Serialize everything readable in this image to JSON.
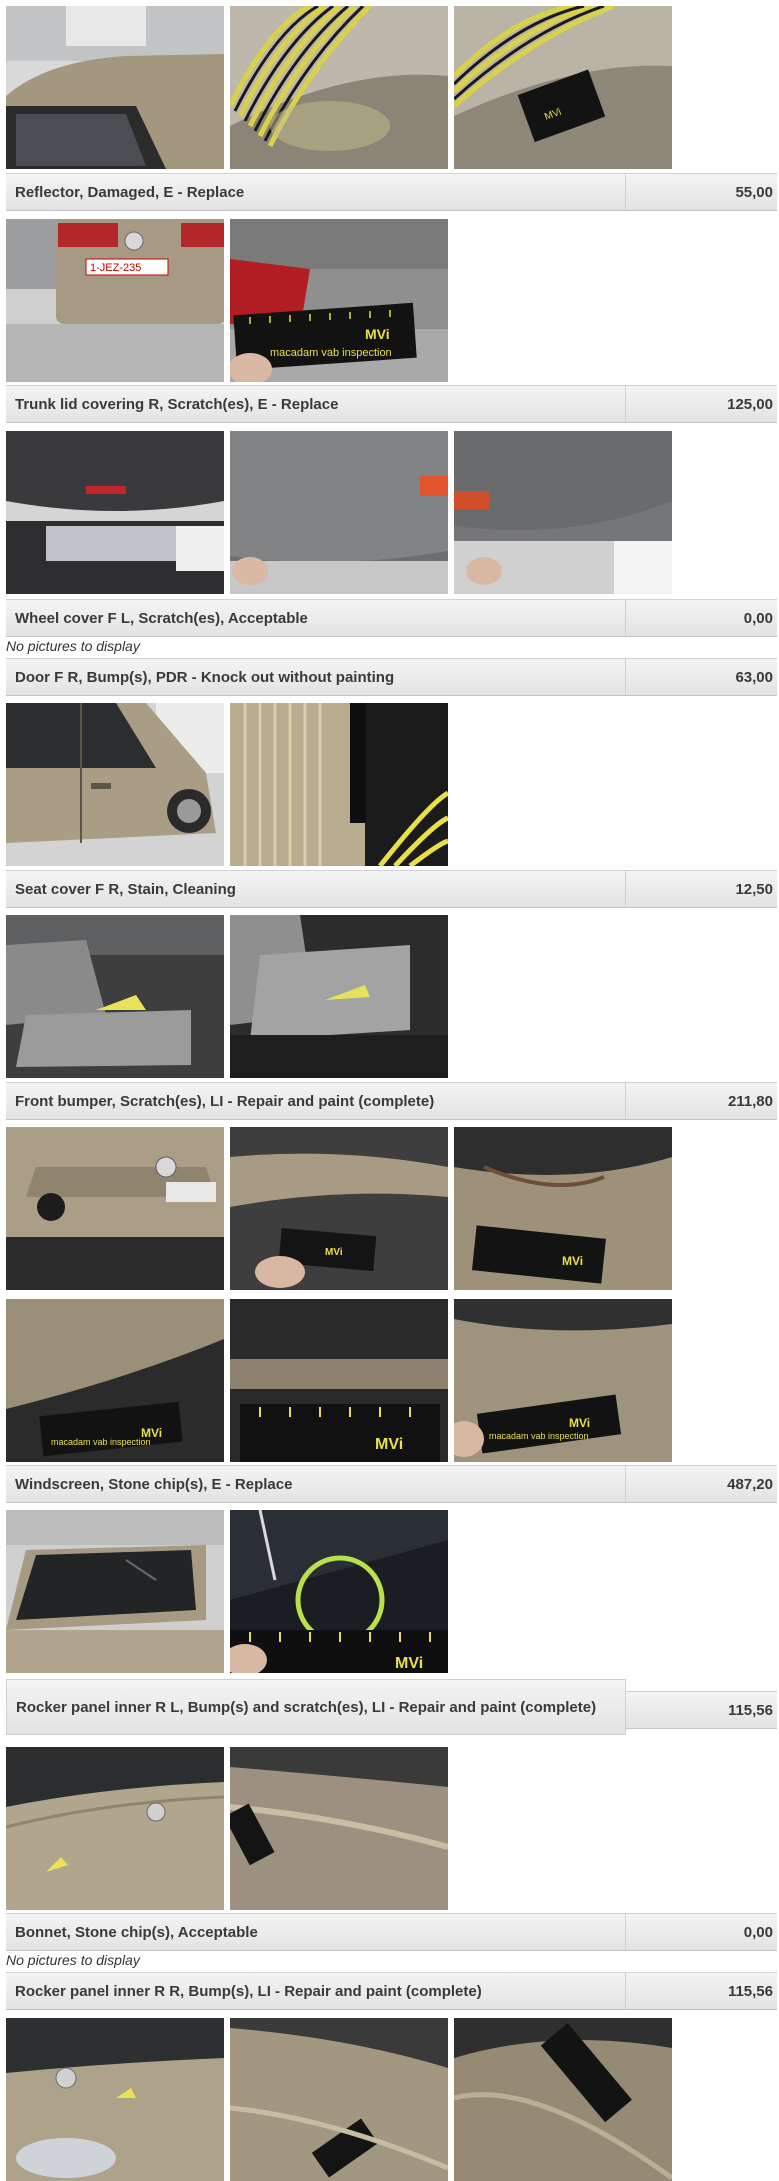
{
  "no_pictures_text": "No pictures to display",
  "damages": [
    {
      "label": "Reflector, Damaged, E - Replace",
      "amount": "55,00"
    },
    {
      "label": "Trunk lid covering R, Scratch(es), E - Replace",
      "amount": "125,00"
    },
    {
      "label": "Wheel cover F L, Scratch(es), Acceptable",
      "amount": "0,00"
    },
    {
      "label": "Door F R, Bump(s), PDR - Knock out without painting",
      "amount": "63,00"
    },
    {
      "label": "Seat cover F R, Stain, Cleaning",
      "amount": "12,50"
    },
    {
      "label": "Front bumper, Scratch(es), LI - Repair and paint (complete)",
      "amount": "211,80"
    },
    {
      "label": "Windscreen, Stone chip(s), E - Replace",
      "amount": "487,20"
    },
    {
      "label": "Rocker panel inner R L, Bump(s) and scratch(es), LI - Repair and paint (complete)",
      "amount": "115,56"
    },
    {
      "label": "Bonnet, Stone chip(s), Acceptable",
      "amount": "0,00"
    },
    {
      "label": "Rocker panel inner R R, Bump(s), LI - Repair and paint (complete)",
      "amount": "115,56"
    }
  ],
  "ruler_brand": "MVi",
  "ruler_text": "macadam vab inspection",
  "plate_text": "1-JEZ-235",
  "colors": {
    "car_body": "#a89a80",
    "ruler": "#111111",
    "ruler_ink": "#e8e04a",
    "bar_bg": "#e8e8e8"
  }
}
